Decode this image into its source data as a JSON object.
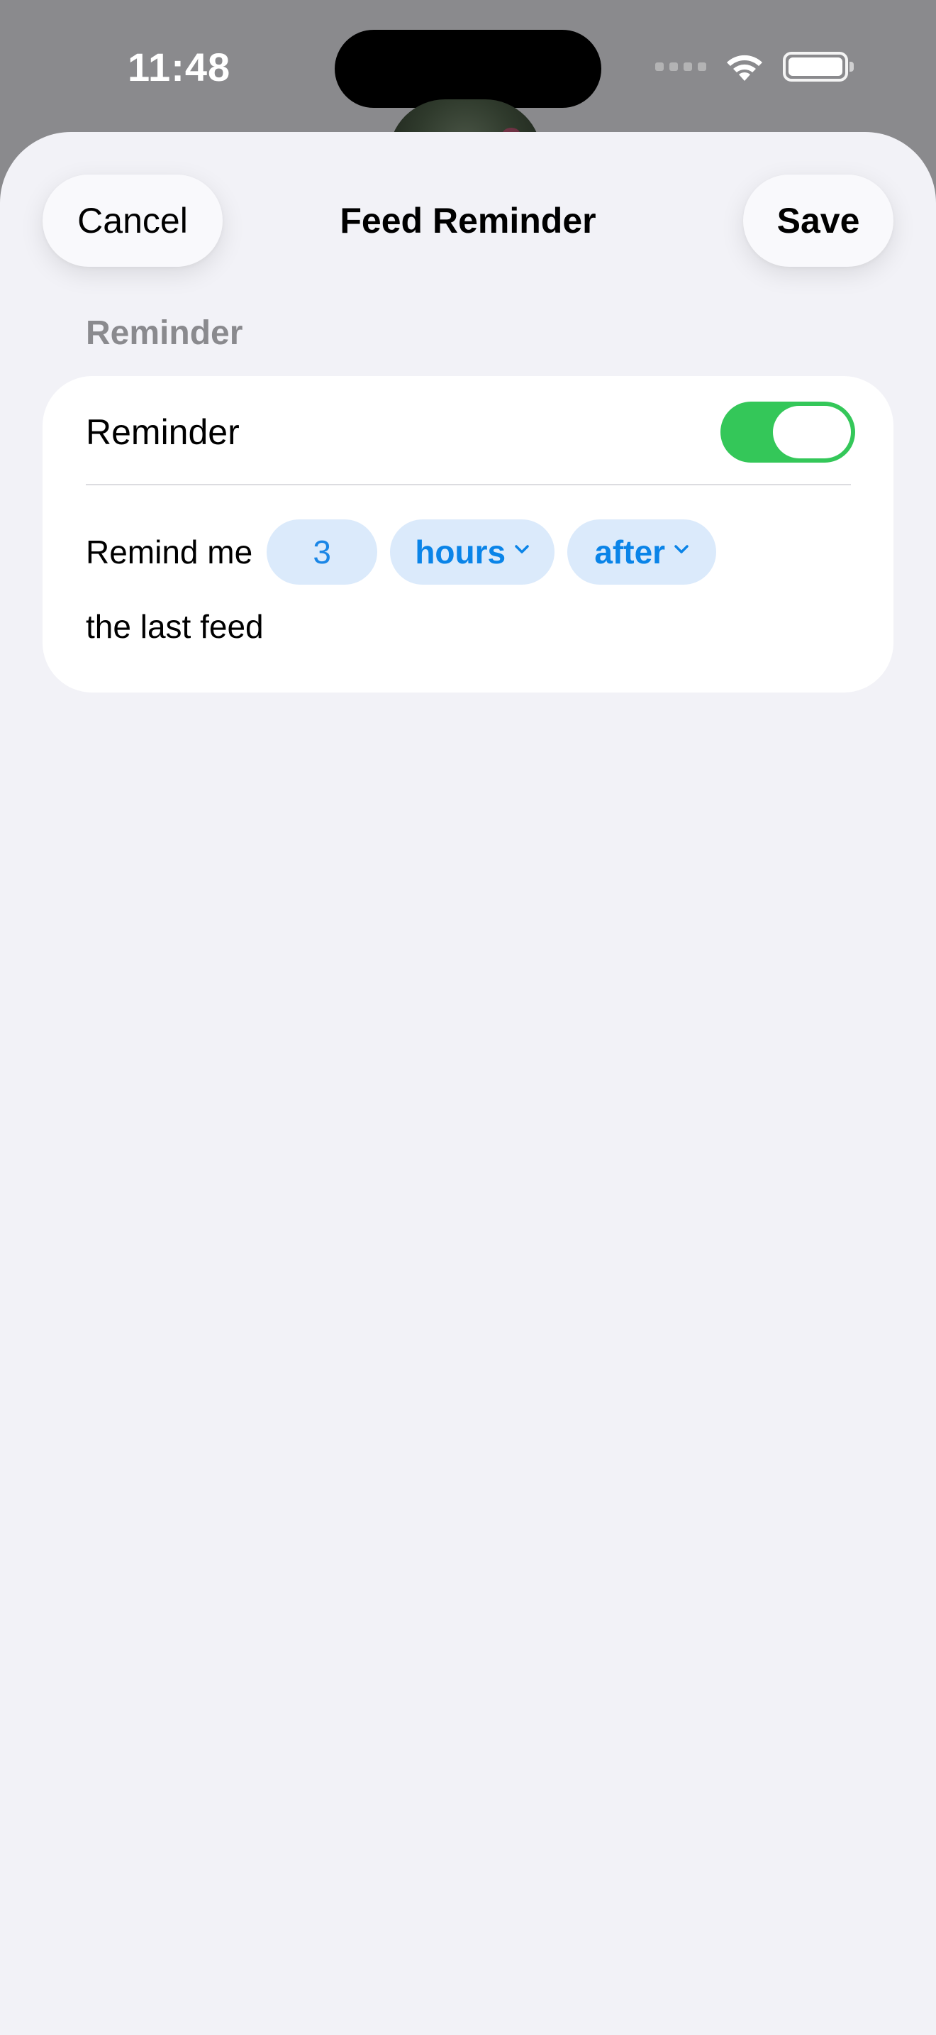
{
  "status_bar": {
    "time": "11:48"
  },
  "nav": {
    "cancel_label": "Cancel",
    "title": "Feed Reminder",
    "save_label": "Save"
  },
  "section": {
    "header": "Reminder"
  },
  "reminder_row": {
    "label": "Reminder",
    "enabled": true
  },
  "schedule": {
    "prefix": "Remind me",
    "amount": "3",
    "unit": "hours",
    "relation": "after",
    "suffix": "the last feed"
  },
  "colors": {
    "accent": "#0a84e8",
    "chip_bg": "#dbeafb",
    "toggle_on": "#34c759",
    "sheet_bg": "#f2f2f7",
    "section_header": "#8a8a8e"
  }
}
